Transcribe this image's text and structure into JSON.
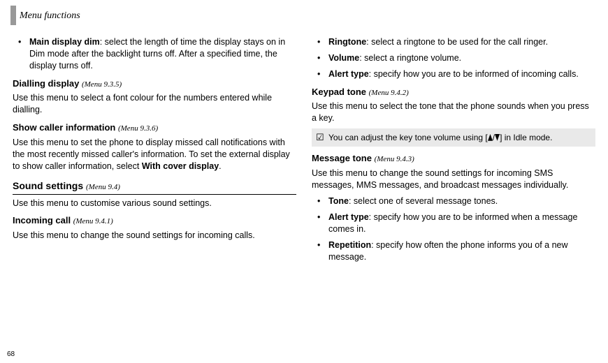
{
  "header": {
    "title": "Menu functions"
  },
  "page_number": "68",
  "left": {
    "bullets": [
      {
        "term": "Main display dim",
        "rest": ": select the length of time the display stays on in Dim mode after the backlight turns off. After a specified time, the display turns off."
      }
    ],
    "h_dialling": {
      "title": "Dialling display",
      "ref": "(Menu 9.3.5)"
    },
    "p_dialling": "Use this menu to select a font colour for the numbers entered while dialling.",
    "h_caller": {
      "title": "Show caller information",
      "ref": "(Menu 9.3.6)"
    },
    "p_caller_a": "Use this menu to set the phone to display missed call notifications with the most recently missed caller's information. To set the external display to show caller information, select ",
    "p_caller_bold": "With cover display",
    "p_caller_b": ".",
    "h_sound": {
      "title": "Sound settings",
      "ref": "(Menu 9.4)"
    },
    "p_sound": "Use this menu to customise various sound settings.",
    "h_incoming": {
      "title": "Incoming call",
      "ref": "(Menu 9.4.1)"
    },
    "p_incoming": "Use this menu to change the sound settings for incoming calls."
  },
  "right": {
    "bullets_top": [
      {
        "term": "Ringtone",
        "rest": ": select a ringtone to be used for the call ringer."
      },
      {
        "term": "Volume",
        "rest": ": select a ringtone volume."
      },
      {
        "term": "Alert type",
        "rest": ": specify how you are to be informed of incoming calls."
      }
    ],
    "h_keypad": {
      "title": "Keypad tone",
      "ref": "(Menu 9.4.2)"
    },
    "p_keypad": "Use this menu to select the tone that the phone sounds when you press a key.",
    "note_a": "You can adjust the key tone volume using [",
    "note_b": "/",
    "note_c": "] in Idle mode.",
    "h_message": {
      "title": "Message tone",
      "ref": "(Menu 9.4.3)"
    },
    "p_message": "Use this menu to change the sound settings for incoming SMS messages, MMS messages, and broadcast messages individually.",
    "bullets_bottom": [
      {
        "term": "Tone",
        "rest": ": select one of several message tones."
      },
      {
        "term": "Alert type",
        "rest": ": specify how you are to be informed when a message comes in."
      },
      {
        "term": "Repetition",
        "rest": ": specify how often the phone informs you of a new message."
      }
    ]
  }
}
